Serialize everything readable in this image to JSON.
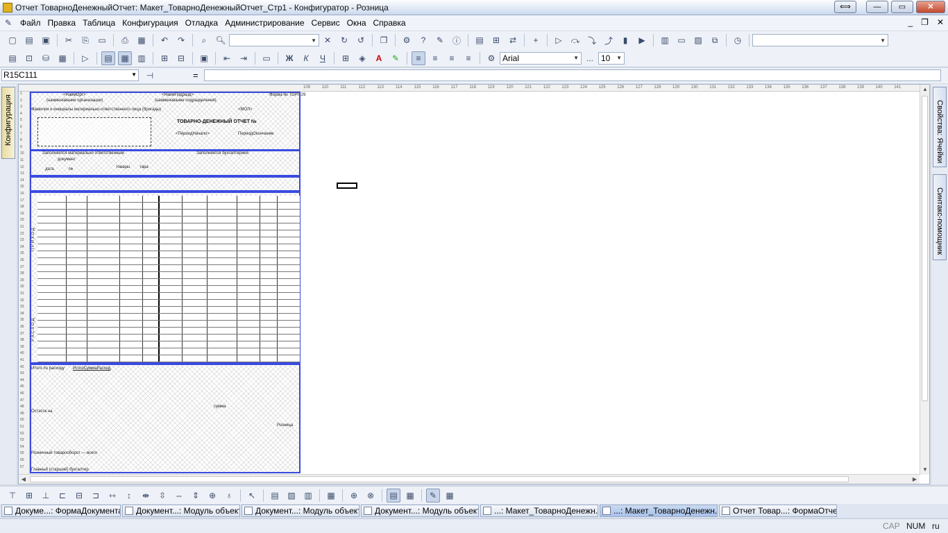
{
  "window": {
    "title": "Отчет ТоварноДенежныйОтчет: Макет_ТоварноДенежныйОтчет_Стр1 - Конфигуратор - Розница",
    "buttons": {
      "swap": "⟺",
      "minimize": "—",
      "maximize": "▭",
      "close": "✕"
    }
  },
  "menu": {
    "items": [
      "Файл",
      "Правка",
      "Таблица",
      "Конфигурация",
      "Отладка",
      "Администрирование",
      "Сервис",
      "Окна",
      "Справка"
    ],
    "mdi": {
      "minimize": "_",
      "restore": "❐",
      "close": "✕"
    }
  },
  "toolbar2": {
    "font_name": "Arial",
    "font_size": "10",
    "bold": "Ж",
    "italic": "К",
    "underline": "Ч",
    "font_more": "..."
  },
  "formula_bar": {
    "cell_ref": "R15C111",
    "equals": "=",
    "value": ""
  },
  "side_tabs": {
    "left": "Конфигурация",
    "right_1": "Свойства: Ячейки",
    "right_2": "Синтакс-помощник"
  },
  "sheet": {
    "form_no": "Форма № ТОРГ-29",
    "title": "ТОВАРНО-ДЕНЕЖНЫЙ ОТЧЕТ №",
    "org_param": "<НаимОрг>",
    "subdiv_param": "<НаимПодразд>",
    "subdiv_caption": "(наименование подразделения)",
    "org_caption": "(наименование организации)",
    "mol_label": "Фамилия и инициалы материально-ответственного лица (бригады)",
    "mol_param": "<МОЛ>",
    "period_start": "<ПериодНачало>",
    "period_end": "ПериодОкончание",
    "section_1": "Заполняется материально ответственным",
    "section_2": "Заполняется бухгалтерией",
    "col_date": "дата",
    "col_no": "№",
    "col_doc": "документ",
    "col_goods": "товары",
    "col_tara": "тара",
    "section_income": "П Р И Х О Д",
    "section_expense": "Р А С Х О Д",
    "total_expense": "Итого по расходу",
    "total_param": "ИтогоСуммаРасход",
    "balance": "Остаток на",
    "retail_turnover": "Розничный товарооборот — всего",
    "accountant": "Главный (старший) бухгалтер",
    "retail_price": "Розница",
    "sum": "сумма"
  },
  "rulers": {
    "columns": [
      "109",
      "110",
      "111",
      "112",
      "113",
      "114",
      "115",
      "116",
      "117",
      "118",
      "119",
      "120",
      "121",
      "122",
      "123",
      "124",
      "125",
      "126",
      "127",
      "128",
      "129",
      "130",
      "131",
      "132",
      "133",
      "134",
      "135",
      "136",
      "137",
      "138",
      "139",
      "140",
      "141"
    ],
    "rows": [
      "1",
      "2",
      "3",
      "4",
      "5",
      "6",
      "7",
      "8",
      "9",
      "10",
      "11",
      "12",
      "13",
      "14",
      "15",
      "16",
      "17",
      "18",
      "19",
      "20",
      "21",
      "22",
      "23",
      "24",
      "25",
      "26",
      "27",
      "28",
      "29",
      "30",
      "31",
      "32",
      "33",
      "34",
      "35",
      "36",
      "37",
      "38",
      "39",
      "40",
      "41",
      "42",
      "43",
      "44",
      "45",
      "46",
      "47",
      "48",
      "49",
      "50",
      "51",
      "52",
      "53",
      "54",
      "55",
      "56",
      "57"
    ]
  },
  "taskbar": [
    {
      "label": "Докуме...: ФормаДокумента",
      "active": false
    },
    {
      "label": "Документ...: Модуль объекта",
      "active": false
    },
    {
      "label": "Документ...: Модуль объекта",
      "active": false
    },
    {
      "label": "Документ...: Модуль объекта",
      "active": false
    },
    {
      "label": "...: Макет_ТоварноДенежн...",
      "active": false
    },
    {
      "label": "...: Макет_ТоварноДенежн...",
      "active": true
    },
    {
      "label": "Отчет Товар...: ФормаОтчета",
      "active": false
    }
  ],
  "status": {
    "cap": "CAP",
    "num": "NUM",
    "lang": "ru"
  },
  "colors": {
    "block_border": "#3a4be0",
    "title_gradient_bottom": "#cbd9ee"
  }
}
